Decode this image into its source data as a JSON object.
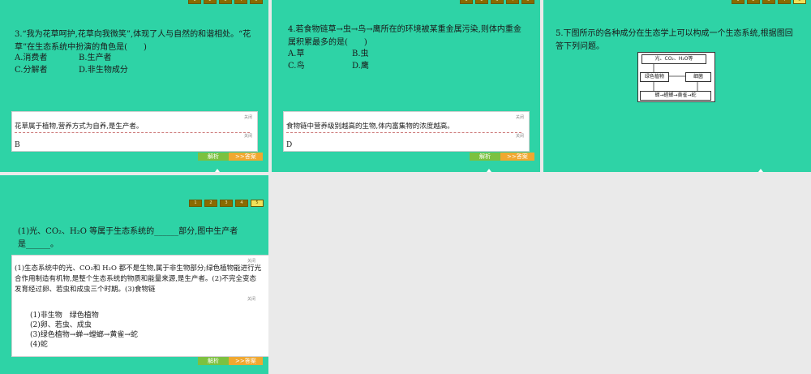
{
  "nav": [
    "1",
    "2",
    "3",
    "4",
    "5"
  ],
  "slide1": {
    "question": "3.“我为花草呵护,花草向我微笑”,体现了人与自然的和谐相处。“花草”在生态系统中扮演的角色是(　　)",
    "options": [
      "A.消费者",
      "B.生产者",
      "C.分解者",
      "D.非生物成分"
    ],
    "close1": "关闭",
    "explanation": "花草属于植物,营养方式为自养,是生产者。",
    "close2": "关闭",
    "answer": "B",
    "btn_explain": "解析",
    "btn_answer": ">>答案"
  },
  "slide2": {
    "question": "4.若食物链草→虫→鸟→鹰所在的环境被某重金属污染,则体内重金属积累最多的是(　　)",
    "options": [
      "A.草",
      "B.虫",
      "C.鸟",
      "D.鹰"
    ],
    "close1": "关闭",
    "explanation": "食物链中营养级别越高的生物,体内富集物的浓度越高。",
    "close2": "关闭",
    "answer": "D",
    "btn_explain": "解析",
    "btn_answer": ">>答案"
  },
  "slide3": {
    "question": "5.下图所示的各种成分在生态学上可以构成一个生态系统,根据图回答下列问题。",
    "diagram": {
      "top": "光、CO₂、H₂O等",
      "plant": "绿色植物",
      "bacteria": "细菌",
      "chain": "蝉→螳螂→黄雀→蛇"
    }
  },
  "slide4": {
    "question": "(1)光、CO₂、H₂O 等属于生态系统的______部分,图中生产者是______。",
    "close1": "关闭",
    "explanation": "(1)生态系统中的光、CO₂和 H₂O 都不是生物,属于非生物部分;绿色植物能进行光合作用制造有机物,是整个生态系统的物质和能量来源,是生产者。(2)不完全变态发育经过卵、若虫和成虫三个时期。(3)食物链",
    "close2": "关闭",
    "answers": [
      "(1)非生物　绿色植物",
      "(2)卵、若虫、成虫",
      "(3)绿色植物→蝉→螳螂→黄雀→蛇",
      "(4)蛇"
    ],
    "btn_explain": "解析",
    "btn_answer": ">>答案"
  }
}
